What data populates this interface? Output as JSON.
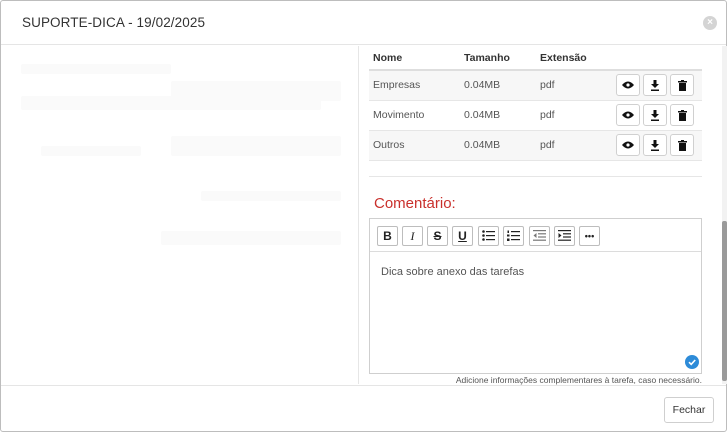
{
  "modal": {
    "title": "SUPORTE-DICA - 19/02/2025",
    "close_icon": "×"
  },
  "files": {
    "headers": [
      "Nome",
      "Tamanho",
      "Extensão"
    ],
    "rows": [
      {
        "name": "Empresas",
        "size": "0.04MB",
        "ext": "pdf"
      },
      {
        "name": "Movimento",
        "size": "0.04MB",
        "ext": "pdf"
      },
      {
        "name": "Outros",
        "size": "0.04MB",
        "ext": "pdf"
      }
    ],
    "action_icons": [
      "eye-icon",
      "download-icon",
      "trash-icon"
    ]
  },
  "comment": {
    "label": "Comentário:",
    "text": "Dica sobre anexo das tarefas",
    "hint": "Adicione informações complementares à tarefa, caso necessário.",
    "toolbar": {
      "bold": "B",
      "italic": "I",
      "strike": "S",
      "underline": "U",
      "more": "•••"
    }
  },
  "footer": {
    "close_label": "Fechar"
  },
  "colors": {
    "accent_red": "#c9302c",
    "grammar_blue": "#2d8bd8"
  }
}
